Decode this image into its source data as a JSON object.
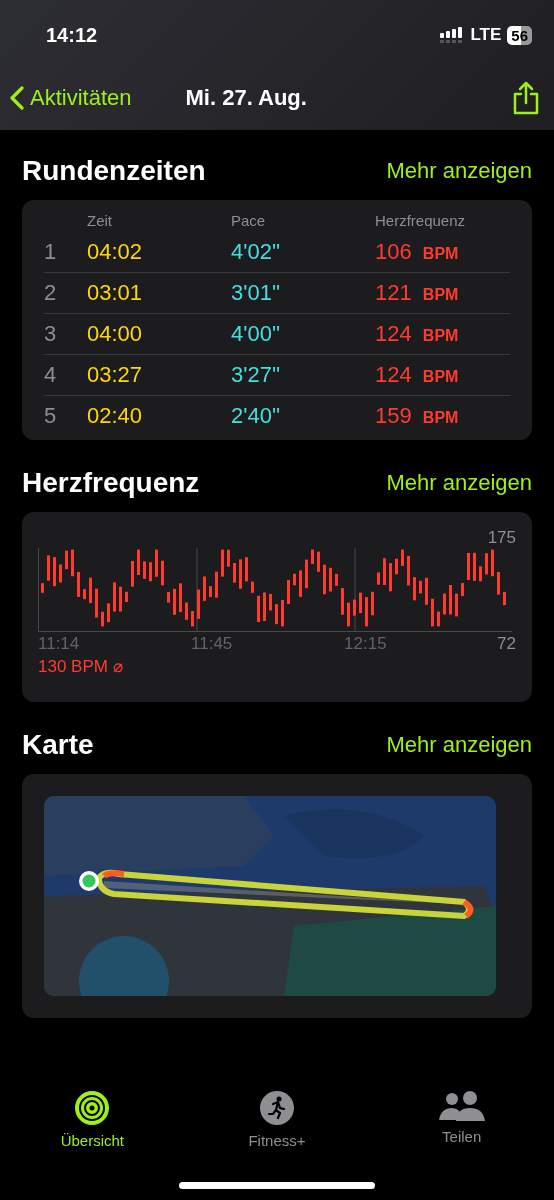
{
  "status_bar": {
    "time": "14:12",
    "network": "LTE",
    "battery": "56"
  },
  "nav": {
    "back": "Aktivitäten",
    "title": "Mi. 27. Aug."
  },
  "sections": [
    {
      "kind": "laps",
      "title": "Rundenzeiten",
      "more": "Mehr anzeigen",
      "columns": [
        "Zeit",
        "Pace",
        "Herzfrequenz"
      ],
      "rows": [
        {
          "index": "1",
          "time": "04:02",
          "pace": "4'02''",
          "hr": "106",
          "unit": "BPM"
        },
        {
          "index": "2",
          "time": "03:01",
          "pace": "3'01''",
          "hr": "121",
          "unit": "BPM"
        },
        {
          "index": "3",
          "time": "04:00",
          "pace": "4'00''",
          "hr": "124",
          "unit": "BPM"
        },
        {
          "index": "4",
          "time": "03:27",
          "pace": "3'27''",
          "hr": "124",
          "unit": "BPM"
        },
        {
          "index": "5",
          "time": "02:40",
          "pace": "2'40''",
          "hr": "159",
          "unit": "BPM"
        }
      ]
    },
    {
      "kind": "heart_rate",
      "title": "Herzfrequenz",
      "more": "Mehr anzeigen",
      "max": "175",
      "min": "72",
      "times": [
        "11:14",
        "11:45",
        "12:15"
      ],
      "average": "130 BPM ⌀"
    },
    {
      "kind": "map",
      "title": "Karte",
      "more": "Mehr anzeigen"
    }
  ],
  "tabs": [
    {
      "kind": "rings",
      "label": "Übersicht",
      "selected": true
    },
    {
      "kind": "runner",
      "label": "Fitness+",
      "selected": false
    },
    {
      "kind": "people",
      "label": "Teilen",
      "selected": false
    }
  ]
}
